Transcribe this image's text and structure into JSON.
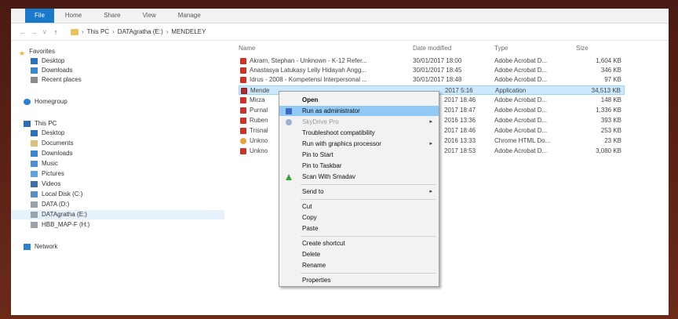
{
  "ribbon": {
    "tabs": [
      "File",
      "Home",
      "Share",
      "View",
      "Manage"
    ]
  },
  "address": {
    "crumbs": [
      "This PC",
      "DATAgratha (E:)",
      "MENDELEY"
    ]
  },
  "sidebar": {
    "favorites": "Favorites",
    "fav_items": [
      "Desktop",
      "Downloads",
      "Recent places"
    ],
    "homegroup": "Homegroup",
    "thispc": "This PC",
    "pc_items": [
      "Desktop",
      "Documents",
      "Downloads",
      "Music",
      "Pictures",
      "Videos",
      "Local Disk (C:)",
      "DATA (D:)",
      "DATAgratha (E:)",
      "HBB_MAP-F (H:)"
    ],
    "network": "Network"
  },
  "columns": {
    "name": "Name",
    "date": "Date modified",
    "type": "Type",
    "size": "Size"
  },
  "files": [
    {
      "name": "Akram, Stephan - Unknown - K-12 Refer...",
      "date": "30/01/2017 18:00",
      "type": "Adobe Acrobat D...",
      "size": "1,604 KB"
    },
    {
      "name": "Anastasya Latukasy Lelly Hidayah Angg...",
      "date": "30/01/2017 18:45",
      "type": "Adobe Acrobat D...",
      "size": "346 KB"
    },
    {
      "name": "Idrus - 2008 - Kompetensi Interpersonal ...",
      "date": "30/01/2017 18:48",
      "type": "Adobe Acrobat D...",
      "size": "97 KB"
    },
    {
      "name": "Mende",
      "date": "2017 5:16",
      "type": "Application",
      "size": "34,513 KB"
    },
    {
      "name": "Mirza",
      "date": "2017 18:46",
      "type": "Adobe Acrobat D...",
      "size": "148 KB"
    },
    {
      "name": "Purnal",
      "date": "2017 18:47",
      "type": "Adobe Acrobat D...",
      "size": "1,336 KB"
    },
    {
      "name": "Ruben",
      "date": "2016 13:36",
      "type": "Adobe Acrobat D...",
      "size": "393 KB"
    },
    {
      "name": "Trisnal",
      "date": "2017 18:46",
      "type": "Adobe Acrobat D...",
      "size": "253 KB"
    },
    {
      "name": "Unkno",
      "date": "2016 13:33",
      "type": "Chrome HTML Do...",
      "size": "23 KB"
    },
    {
      "name": "Unkno",
      "date": "2017 18:53",
      "type": "Adobe Acrobat D...",
      "size": "3,080 KB"
    }
  ],
  "menu": {
    "open": "Open",
    "run_admin": "Run as administrator",
    "skydrive": "SkyDrive Pro",
    "troubleshoot": "Troubleshoot compatibility",
    "run_gpu": "Run with graphics processor",
    "pin_start": "Pin to Start",
    "pin_taskbar": "Pin to Taskbar",
    "scan": "Scan With Smadav",
    "send_to": "Send to",
    "cut": "Cut",
    "copy": "Copy",
    "paste": "Paste",
    "create_shortcut": "Create shortcut",
    "delete": "Delete",
    "rename": "Rename",
    "properties": "Properties"
  },
  "colors": {
    "file_tab": "#1979ca",
    "selection": "#cce8ff",
    "menu_highlight": "#91c9f7",
    "pdf_icon": "#c8332a",
    "frame": "#5a1e14"
  },
  "icons": {
    "pdf": "pdf-icon",
    "app": "application-icon",
    "chrome": "chrome-html-icon",
    "shield": "uac-shield-icon",
    "smadav": "smadav-icon"
  }
}
